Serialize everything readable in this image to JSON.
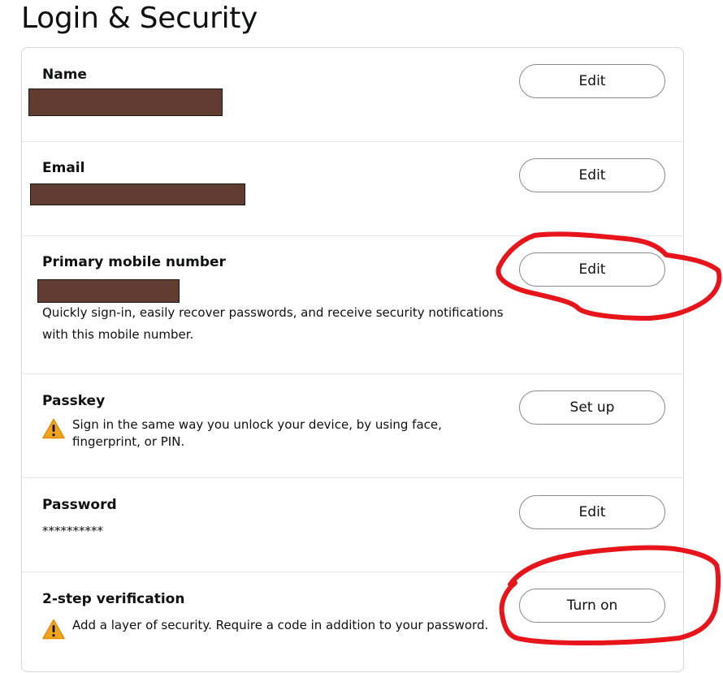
{
  "page_title": "Login & Security",
  "rows": {
    "name": {
      "title": "Name",
      "button": "Edit"
    },
    "email": {
      "title": "Email",
      "button": "Edit"
    },
    "mobile": {
      "title": "Primary mobile number",
      "description": "Quickly sign-in, easily recover passwords, and receive security notifications with this mobile number.",
      "button": "Edit"
    },
    "passkey": {
      "title": "Passkey",
      "warning": "Sign in the same way you unlock your device, by using face, fingerprint, or PIN.",
      "button": "Set up"
    },
    "password": {
      "title": "Password",
      "value": "**********",
      "button": "Edit"
    },
    "two_step": {
      "title": "2-step verification",
      "warning": "Add a layer of security. Require a code in addition to your password.",
      "button": "Turn on"
    }
  },
  "colors": {
    "redaction": "#603d30",
    "annotation": "#e8141c",
    "warning": "#f0a31c"
  },
  "icons": {
    "warning": "warning-triangle-icon"
  }
}
